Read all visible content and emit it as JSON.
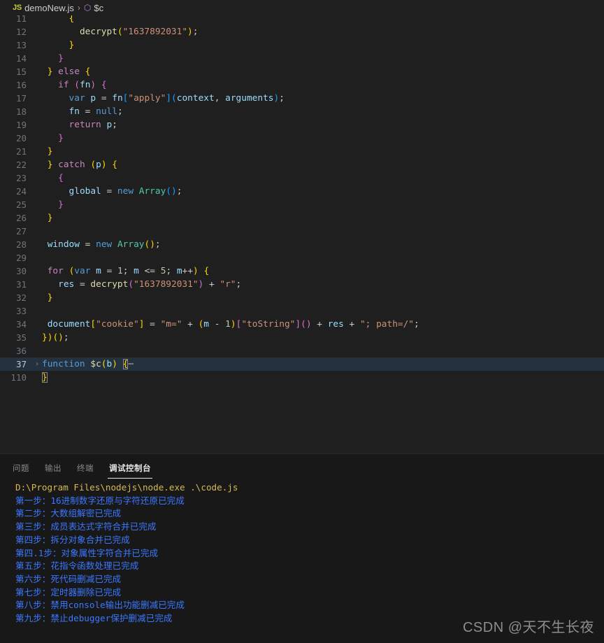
{
  "breadcrumb": {
    "file_badge": "JS",
    "file_name": "demoNew.js",
    "separator": "›",
    "symbol_icon": "⬡",
    "symbol_name": "$c"
  },
  "editor": {
    "active_line": 37,
    "fold_marker": "›",
    "fold_ellipsis": "⋯",
    "lines": [
      {
        "num": "11",
        "text": "      {"
      },
      {
        "num": "12",
        "text": "        decrypt(\"1637892031\");"
      },
      {
        "num": "13",
        "text": "      }"
      },
      {
        "num": "14",
        "text": "    }"
      },
      {
        "num": "15",
        "text": "  } else {"
      },
      {
        "num": "16",
        "text": "    if (fn) {"
      },
      {
        "num": "17",
        "text": "      var p = fn[\"apply\"](context, arguments);"
      },
      {
        "num": "18",
        "text": "      fn = null;"
      },
      {
        "num": "19",
        "text": "      return p;"
      },
      {
        "num": "20",
        "text": "    }"
      },
      {
        "num": "21",
        "text": "  }"
      },
      {
        "num": "22",
        "text": "  } catch (p) {"
      },
      {
        "num": "23",
        "text": "    {"
      },
      {
        "num": "24",
        "text": "      global = new Array();"
      },
      {
        "num": "25",
        "text": "    }"
      },
      {
        "num": "26",
        "text": "  }"
      },
      {
        "num": "27",
        "text": ""
      },
      {
        "num": "28",
        "text": "  window = new Array();"
      },
      {
        "num": "29",
        "text": ""
      },
      {
        "num": "30",
        "text": "  for (var m = 1; m <= 5; m++) {"
      },
      {
        "num": "31",
        "text": "    res = decrypt(\"1637892031\") + \"r\";"
      },
      {
        "num": "32",
        "text": "  }"
      },
      {
        "num": "33",
        "text": ""
      },
      {
        "num": "34",
        "text": "  document[\"cookie\"] = \"m=\" + (m - 1)[\"toString\"]() + res + \"; path=/\";"
      },
      {
        "num": "35",
        "text": "})();"
      },
      {
        "num": "36",
        "text": ""
      },
      {
        "num": "37",
        "text": "function $c(b) {⋯"
      },
      {
        "num": "110",
        "text": "}"
      }
    ]
  },
  "panel": {
    "tabs": [
      {
        "label": "问题",
        "active": false
      },
      {
        "label": "输出",
        "active": false
      },
      {
        "label": "终端",
        "active": false
      },
      {
        "label": "调试控制台",
        "active": true
      }
    ],
    "console": {
      "command": "D:\\Program Files\\nodejs\\node.exe .\\code.js",
      "lines": [
        "第一步：16进制数字还原与字符还原已完成",
        "第二步：大数组解密已完成",
        "第三步：成员表达式字符合并已完成",
        "第四步：拆分对象合并已完成",
        "第四.1步：对象属性字符合并已完成",
        "第五步：花指令函数处理已完成",
        "第六步：死代码删减已完成",
        "第七步：定时器删除已完成",
        "第八步：禁用console输出功能删减已完成",
        "第九步：禁止debugger保护删减已完成"
      ]
    }
  },
  "watermark": "CSDN @天不生长夜",
  "colors": {
    "editor_bg": "#1f1f1f",
    "panel_bg": "#181818",
    "active_line_bg": "#243240",
    "line_number": "#6e7681",
    "keyword": "#c586c0",
    "storage": "#569cd6",
    "variable": "#9cdcfe",
    "function": "#dcdcaa",
    "string": "#ce9178",
    "number": "#b5cea8",
    "class": "#4ec9b0",
    "console_cmd": "#d7ba52",
    "console_text": "#3b78ff",
    "watermark": "#8d8d8d"
  }
}
